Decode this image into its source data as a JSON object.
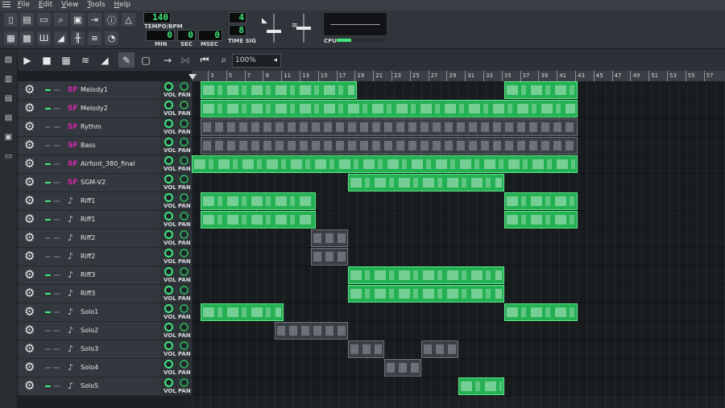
{
  "menu": [
    "File",
    "Edit",
    "View",
    "Tools",
    "Help"
  ],
  "transport": {
    "tempo": "140",
    "tempo_label": "TEMPO/BPM",
    "min": "0",
    "min_label": "MIN",
    "sec": "0",
    "sec_label": "SEC",
    "msec": "0",
    "msec_label": "MSEC",
    "timesig_num": "4",
    "timesig_den": "8",
    "timesig_label": "TIME SIG",
    "cpu_label": "CPU"
  },
  "zoom": "100%",
  "ruler": [
    "3",
    "5",
    "7",
    "9",
    "11",
    "13",
    "15",
    "17",
    "19",
    "21",
    "23",
    "25",
    "27",
    "29",
    "31",
    "33",
    "35",
    "37",
    "39",
    "41",
    "43",
    "45",
    "47",
    "49",
    "51",
    "53",
    "55",
    "57"
  ],
  "tracks": [
    {
      "name": "Melody1",
      "type": "sf",
      "muted": false,
      "clips": [
        {
          "s": 1,
          "e": 18,
          "c": "g"
        },
        {
          "s": 34,
          "e": 42,
          "c": "g"
        }
      ]
    },
    {
      "name": "Melody2",
      "type": "sf",
      "muted": false,
      "clips": [
        {
          "s": 1,
          "e": 42,
          "c": "g"
        }
      ]
    },
    {
      "name": "Rythm",
      "type": "sf",
      "muted": true,
      "clips": [
        {
          "s": 1,
          "e": 42,
          "c": "d"
        }
      ]
    },
    {
      "name": "Bass",
      "type": "sf",
      "muted": true,
      "clips": [
        {
          "s": 1,
          "e": 42,
          "c": "d"
        }
      ]
    },
    {
      "name": "Airfont_380_final",
      "type": "sf",
      "muted": false,
      "clips": [
        {
          "s": 0,
          "e": 42,
          "c": "g"
        }
      ]
    },
    {
      "name": "SGM-V2",
      "type": "sf",
      "muted": false,
      "clips": [
        {
          "s": 17,
          "e": 34,
          "c": "g"
        }
      ]
    },
    {
      "name": "Riff1",
      "type": "note",
      "muted": false,
      "clips": [
        {
          "s": 1,
          "e": 13.5,
          "c": "g"
        },
        {
          "s": 34,
          "e": 42,
          "c": "g"
        }
      ]
    },
    {
      "name": "Riff1",
      "type": "note",
      "muted": false,
      "clips": [
        {
          "s": 1,
          "e": 13.5,
          "c": "g"
        },
        {
          "s": 34,
          "e": 42,
          "c": "g"
        }
      ]
    },
    {
      "name": "Riff2",
      "type": "note",
      "muted": true,
      "clips": [
        {
          "s": 13,
          "e": 17,
          "c": "d"
        }
      ]
    },
    {
      "name": "Riff2",
      "type": "note",
      "muted": true,
      "clips": [
        {
          "s": 13,
          "e": 17,
          "c": "d"
        }
      ]
    },
    {
      "name": "Riff3",
      "type": "note",
      "muted": false,
      "clips": [
        {
          "s": 17,
          "e": 34,
          "c": "g"
        }
      ]
    },
    {
      "name": "Riff3",
      "type": "note",
      "muted": false,
      "clips": [
        {
          "s": 17,
          "e": 34,
          "c": "g"
        }
      ]
    },
    {
      "name": "Solo1",
      "type": "note",
      "muted": false,
      "clips": [
        {
          "s": 1,
          "e": 10,
          "c": "g"
        },
        {
          "s": 34,
          "e": 42,
          "c": "g"
        }
      ]
    },
    {
      "name": "Solo2",
      "type": "note",
      "muted": true,
      "clips": [
        {
          "s": 9,
          "e": 17,
          "c": "d"
        }
      ]
    },
    {
      "name": "Solo3",
      "type": "note",
      "muted": true,
      "clips": [
        {
          "s": 17,
          "e": 21,
          "c": "d"
        },
        {
          "s": 25,
          "e": 29,
          "c": "d"
        }
      ]
    },
    {
      "name": "Solo4",
      "type": "note",
      "muted": true,
      "clips": [
        {
          "s": 21,
          "e": 25,
          "c": "d"
        }
      ]
    },
    {
      "name": "Solo5",
      "type": "note",
      "muted": false,
      "clips": [
        {
          "s": 29,
          "e": 34,
          "c": "g"
        }
      ]
    }
  ],
  "labels": {
    "vol": "VOL",
    "pan": "PAN"
  }
}
